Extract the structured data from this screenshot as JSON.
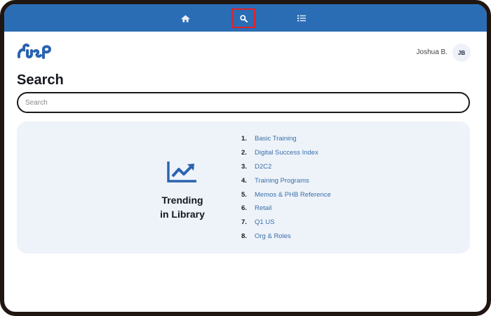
{
  "nav": {
    "items": [
      {
        "icon": "home-icon"
      },
      {
        "icon": "search-icon",
        "selected": true
      },
      {
        "icon": "list-icon"
      }
    ],
    "bar_color": "#2a6db5",
    "highlight_color": "#e0222a"
  },
  "header": {
    "logo_icon": "brand-logo-icon",
    "user_name": "Joshua B.",
    "avatar_initials": "JB"
  },
  "page": {
    "title": "Search"
  },
  "search": {
    "placeholder": "Search",
    "value": ""
  },
  "trending": {
    "icon": "trending-up-icon",
    "title_line1": "Trending",
    "title_line2": "in Library",
    "items": [
      {
        "num": "1.",
        "label": "Basic Training"
      },
      {
        "num": "2.",
        "label": "Digital Success Index"
      },
      {
        "num": "3.",
        "label": "D2C2"
      },
      {
        "num": "4.",
        "label": "Training Programs"
      },
      {
        "num": "5.",
        "label": "Memos & PHB Reference"
      },
      {
        "num": "6.",
        "label": "Retail"
      },
      {
        "num": "7.",
        "label": "Q1 US"
      },
      {
        "num": "8.",
        "label": "Org & Roles"
      }
    ]
  }
}
